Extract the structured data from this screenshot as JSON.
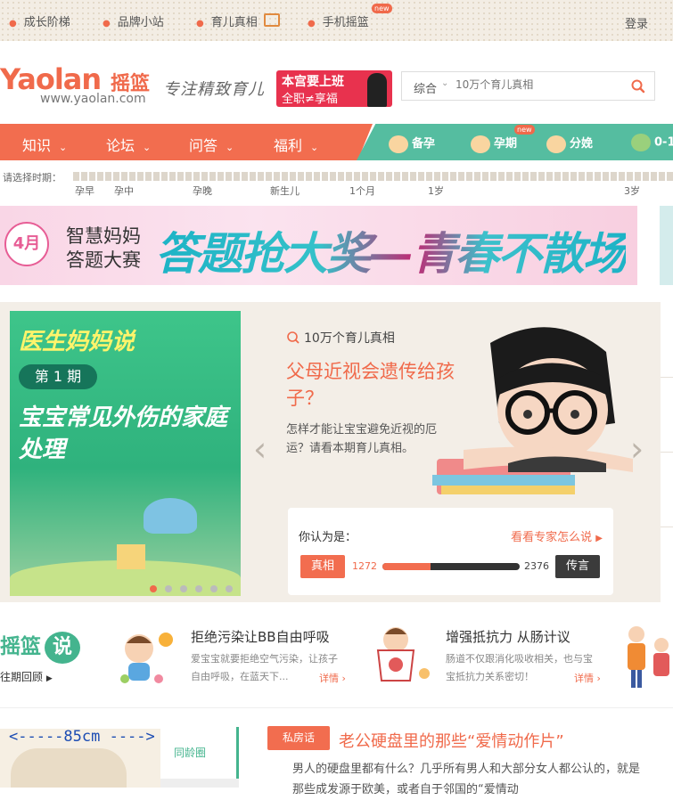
{
  "topnav": {
    "links": [
      "成长阶梯",
      "品牌小站",
      "育儿真相",
      "手机摇篮"
    ],
    "new_badge": "new",
    "login": "登录"
  },
  "header": {
    "logo_text": "Yaolan",
    "logo_cn": "摇篮",
    "logo_url": "www.yaolan.com",
    "slogan": "专注精致育儿",
    "promo_line1": "本宫要上班",
    "promo_line2": "全职≠享福",
    "search_category": "综合",
    "search_placeholder": "10万个育儿真相"
  },
  "mainnav": {
    "items": [
      "知识",
      "论坛",
      "问答",
      "福利"
    ],
    "stages": [
      "备孕",
      "孕期",
      "分娩",
      "0-1"
    ],
    "stage_new_badge": "new"
  },
  "period": {
    "label": "请选择时期：",
    "ticks": [
      "孕早",
      "孕中",
      "孕晚",
      "新生儿",
      "1个月",
      "1岁",
      "3岁"
    ]
  },
  "banner": {
    "month": "4月",
    "line1": "智慧妈妈",
    "line2": "答题大赛",
    "headline": "答题抢大奖—青春不散场"
  },
  "feature": {
    "image_title": "医生妈妈说",
    "image_episode": "第 1 期",
    "image_main": "宝宝常见外伤的家庭处理",
    "section": "10万个育儿真相",
    "question": "父母近视会遗传给孩子？",
    "desc": "怎样才能让宝宝避免近视的厄运？请看本期育儿真相。",
    "poll_prompt": "你认为是：",
    "poll_expert": "看看专家怎么说",
    "truth_label": "真相",
    "truth_count": "1272",
    "rumor_label": "传言",
    "rumor_count": "2376",
    "truth_fraction": 0.35
  },
  "say": {
    "logo": "摇篮",
    "logo_bubble": "说",
    "archive": "往期回顾",
    "items": [
      {
        "title": "拒绝污染让BB自由呼吸",
        "desc": "爱宝宝就要拒绝空气污染，让孩子自由呼吸，在蓝天下...",
        "more": "详情"
      },
      {
        "title": "增强抵抗力 从肠计议",
        "desc": "肠道不仅跟消化吸收相关，也与宝宝抵抗力关系密切！",
        "more": "详情"
      }
    ]
  },
  "bottom": {
    "size_label": "<-----85cm ---->",
    "tongling": "同龄圈",
    "tag": "私房话",
    "article_title": "老公硬盘里的那些“爱情动作片”",
    "article_body": "男人的硬盘里都有什么？几乎所有男人和大部分女人都公认的，就是那些成发源于欧美，或者自于邻国的“爱情动"
  },
  "colors": {
    "accent": "#f06a4b",
    "nav_orange": "#f26d4f",
    "nav_teal": "#55bda0",
    "green": "#44b48e"
  }
}
